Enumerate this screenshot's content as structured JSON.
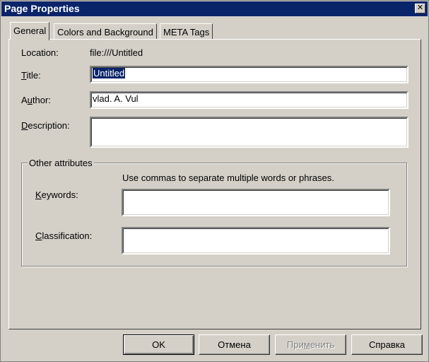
{
  "window": {
    "title": "Page Properties",
    "close_glyph": "✕"
  },
  "tabs": [
    {
      "label": "General",
      "active": true
    },
    {
      "label": "Colors and Background",
      "active": false
    },
    {
      "label": "META Tags",
      "active": false
    }
  ],
  "general": {
    "location_label": "Location:",
    "location_value": "file:///Untitled",
    "title_label_u": "T",
    "title_label_rest": "itle:",
    "title_value": "Untitled",
    "author_label_a": "A",
    "author_label_u": "u",
    "author_label_rest": "thor:",
    "author_value": "vlad. A. Vul",
    "description_label_u": "D",
    "description_label_rest": "escription:",
    "description_value": ""
  },
  "other": {
    "group_title": "Other attributes",
    "hint": "Use commas to separate multiple words or phrases.",
    "keywords_label_u": "K",
    "keywords_label_rest": "eywords:",
    "keywords_value": "",
    "classification_label_u": "C",
    "classification_label_rest": "lassification:",
    "classification_value": ""
  },
  "buttons": {
    "ok": "OK",
    "cancel": "Отмена",
    "apply_a": "При",
    "apply_u": "м",
    "apply_rest": "енить",
    "help": "Справка"
  }
}
